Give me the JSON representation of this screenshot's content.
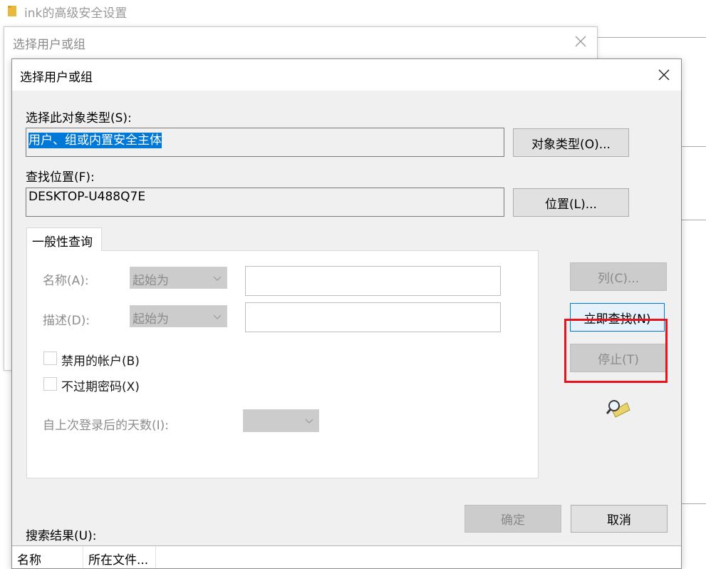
{
  "parent_window": {
    "title": "ink的高级安全设置",
    "folder_icon": "folder-icon"
  },
  "back_dialog": {
    "title": "选择用户或组",
    "close_icon": "close-icon"
  },
  "dialog": {
    "title": "选择用户或组",
    "close_icon": "close-icon",
    "object_type": {
      "label": "选择此对象类型(S):",
      "value": "用户、组或内置安全主体",
      "button": "对象类型(O)..."
    },
    "location": {
      "label": "查找位置(F):",
      "value": "DESKTOP-U488Q7E",
      "button": "位置(L)..."
    },
    "tab": {
      "label": "一般性查询"
    },
    "query": {
      "name_label": "名称(A):",
      "name_mode": "起始为",
      "name_value": "",
      "desc_label": "描述(D):",
      "desc_mode": "起始为",
      "desc_value": "",
      "disabled_accounts_label": "禁用的帐户(B)",
      "non_expiring_password_label": "不过期密码(X)",
      "days_since_logon_label": "自上次登录后的天数(I):",
      "days_since_logon_value": ""
    },
    "side_buttons": {
      "columns": "列(C)...",
      "find_now": "立即查找(N)",
      "stop": "停止(T)",
      "search_icon": "search-magnifier-icon"
    },
    "footer": {
      "ok": "确定",
      "cancel": "取消"
    },
    "results": {
      "label": "搜索结果(U):",
      "columns": [
        "名称",
        "所在文件..."
      ]
    }
  },
  "colors": {
    "highlight_red": "#e8141c",
    "selection_blue": "#0078d7",
    "dialog_bg": "#f0f0f0"
  }
}
